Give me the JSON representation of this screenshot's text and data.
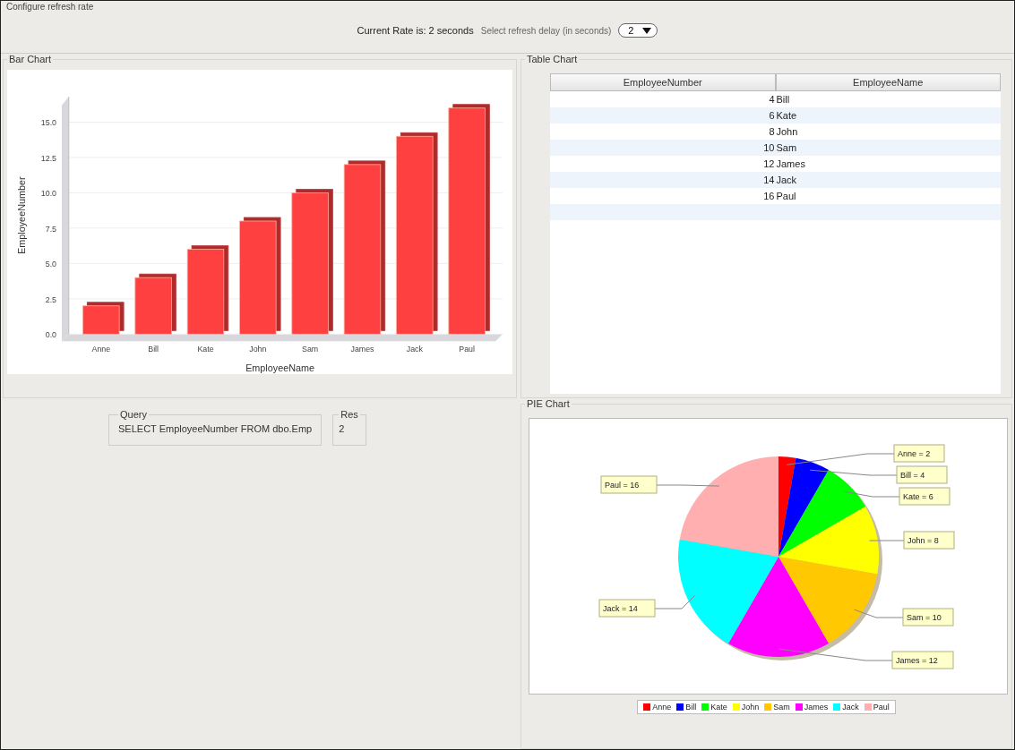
{
  "header": {
    "title": "Configure refresh rate",
    "current_rate": "Current Rate is: 2 seconds",
    "delay_label": "Select refresh delay (in seconds)",
    "delay_value": "2"
  },
  "bar_panel": {
    "title": "Bar Chart",
    "chart_data": {
      "type": "bar",
      "xlabel": "EmployeeName",
      "ylabel": "EmployeeNumber",
      "categories": [
        "Anne",
        "Bill",
        "Kate",
        "John",
        "Sam",
        "James",
        "Jack",
        "Paul"
      ],
      "series": [
        {
          "color": "#ff4040",
          "values": [
            2,
            4,
            6,
            8,
            10,
            12,
            14,
            16
          ]
        }
      ],
      "grid": true,
      "ylim": [
        0,
        16.8
      ],
      "yticks": [
        {
          "value": 0,
          "label": "0.0"
        },
        {
          "value": 2.5,
          "label": "2.5"
        },
        {
          "value": 5,
          "label": "5.0"
        },
        {
          "value": 7.5,
          "label": "7.5"
        },
        {
          "value": 10,
          "label": "10.0"
        },
        {
          "value": 12.5,
          "label": "12.5"
        },
        {
          "value": 15,
          "label": "15.0"
        }
      ]
    }
  },
  "table_panel": {
    "title": "Table Chart",
    "columns": [
      "EmployeeNumber",
      "EmployeeName"
    ],
    "rows": [
      [
        "4",
        "Bill"
      ],
      [
        "6",
        "Kate"
      ],
      [
        "8",
        "John"
      ],
      [
        "10",
        "Sam"
      ],
      [
        "12",
        "James"
      ],
      [
        "14",
        "Jack"
      ],
      [
        "16",
        "Paul"
      ]
    ]
  },
  "query_panel": {
    "title": "Query",
    "value": "SELECT EmployeeNumber FROM  dbo.Emp"
  },
  "result_panel": {
    "title": "Res",
    "value": "2"
  },
  "pie_panel": {
    "title": "PIE Chart",
    "chart_data": {
      "type": "pie",
      "categories": [
        "Anne",
        "Bill",
        "Kate",
        "John",
        "Sam",
        "James",
        "Jack",
        "Paul"
      ],
      "values": [
        2,
        4,
        6,
        8,
        10,
        12,
        14,
        16
      ],
      "value_labels": [
        "Anne = 2",
        "Bill = 4",
        "Kate = 6",
        "John = 8",
        "Sam = 10",
        "James = 12",
        "Jack = 14",
        "Paul = 16"
      ]
    },
    "slices": [
      {
        "color": "#ff0000"
      },
      {
        "color": "#0000ff"
      },
      {
        "color": "#00ff00"
      },
      {
        "color": "#ffff00"
      },
      {
        "color": "#ffc800"
      },
      {
        "color": "#ff00ff"
      },
      {
        "color": "#00ffff"
      },
      {
        "color": "#ffafaf"
      }
    ]
  }
}
